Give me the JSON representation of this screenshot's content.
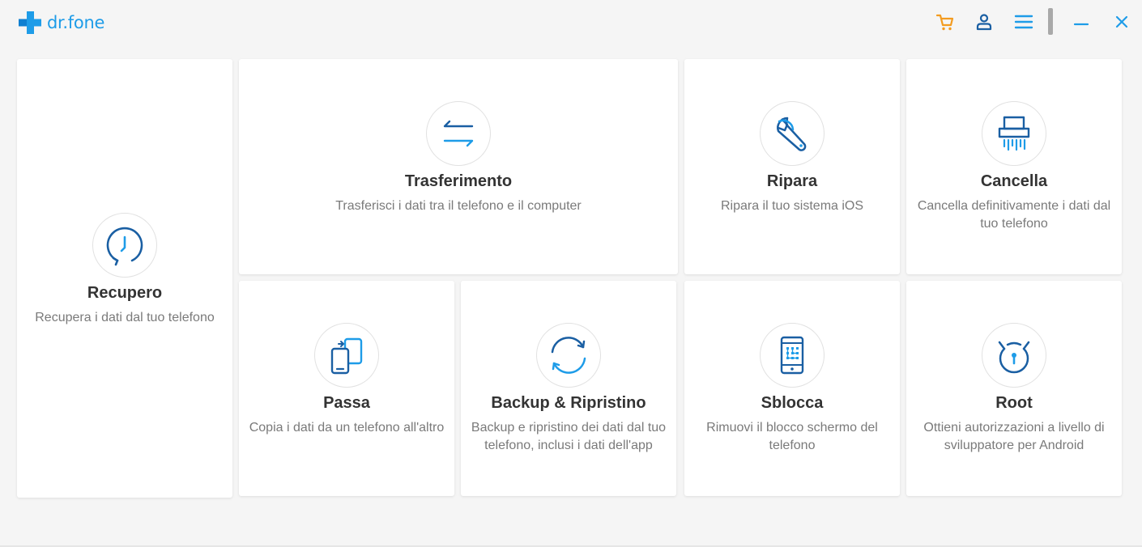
{
  "app": {
    "name": "dr.fone"
  },
  "colors": {
    "accent": "#1e9ce8",
    "cart": "#f39b1f",
    "dark_icon": "#1a5fa3"
  },
  "cards": {
    "recupero": {
      "title": "Recupero",
      "desc": "Recupera i dati dal tuo telefono",
      "icon": "clock-recovery-icon"
    },
    "trasferimento": {
      "title": "Trasferimento",
      "desc": "Trasferisci i dati tra il telefono e il computer",
      "icon": "transfer-arrows-icon"
    },
    "ripara": {
      "title": "Ripara",
      "desc": "Ripara il tuo sistema iOS",
      "icon": "wrench-icon"
    },
    "cancella": {
      "title": "Cancella",
      "desc": "Cancella definitivamente i dati dal tuo telefono",
      "icon": "shredder-icon"
    },
    "passa": {
      "title": "Passa",
      "desc": "Copia i dati da un telefono all'altro",
      "icon": "phone-switch-icon"
    },
    "backup": {
      "title": "Backup & Ripristino",
      "desc": "Backup e ripristino dei dati dal tuo telefono, inclusi i dati dell'app",
      "icon": "sync-circle-icon"
    },
    "sblocca": {
      "title": "Sblocca",
      "desc": "Rimuovi il blocco schermo del telefono",
      "icon": "phone-grid-unlock-icon"
    },
    "root": {
      "title": "Root",
      "desc": "Ottieni autorizzazioni a livello di sviluppatore per Android",
      "icon": "android-root-icon"
    }
  }
}
